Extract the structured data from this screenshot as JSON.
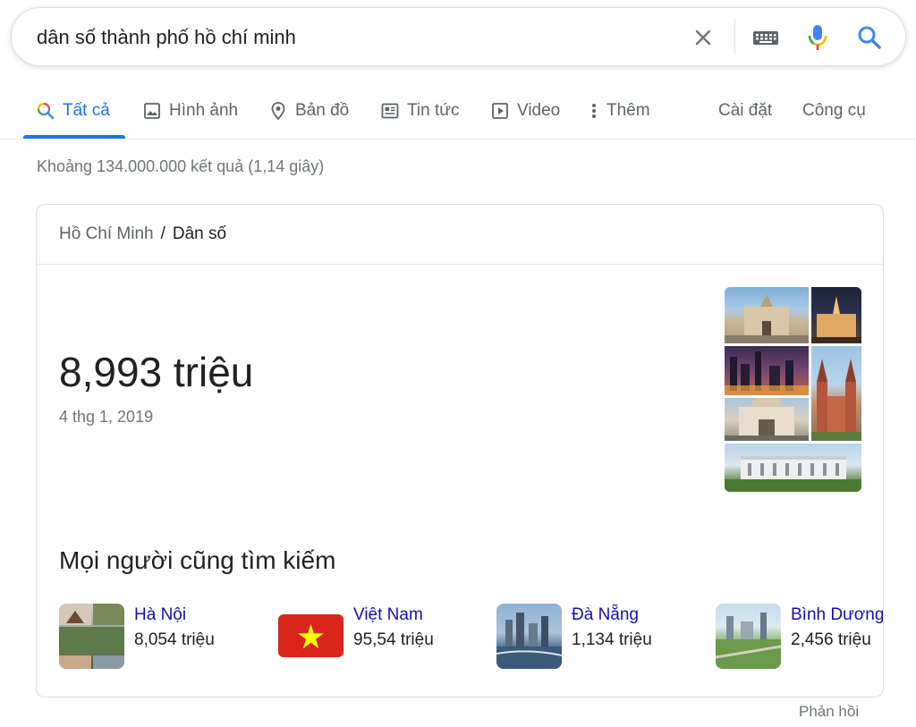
{
  "search": {
    "query": "dân số thành phố hồ chí minh"
  },
  "tabs": [
    {
      "label": "Tất cả",
      "icon": "search-icon",
      "active": true
    },
    {
      "label": "Hình ảnh",
      "icon": "image-icon"
    },
    {
      "label": "Bản đồ",
      "icon": "map-pin-icon"
    },
    {
      "label": "Tin tức",
      "icon": "news-icon"
    },
    {
      "label": "Video",
      "icon": "video-play-icon"
    },
    {
      "label": "Thêm",
      "icon": "more-vertical-icon"
    }
  ],
  "tools": {
    "settings_label": "Cài đặt",
    "tools_label": "Công cụ"
  },
  "result_stats": "Khoảng 134.000.000 kết quả (1,14 giây)",
  "card": {
    "breadcrumb": {
      "parent": "Hồ Chí Minh",
      "separator": "/",
      "current": "Dân số"
    },
    "population": "8,993 triệu",
    "date": "4 thg 1, 2019",
    "people_also_search": {
      "title": "Mọi người cũng tìm kiếm",
      "items": [
        {
          "name": "Hà Nội",
          "value": "8,054 triệu"
        },
        {
          "name": "Việt Nam",
          "value": "95,54 triệu"
        },
        {
          "name": "Đà Nẵng",
          "value": "1,134 triệu"
        },
        {
          "name": "Bình Dương",
          "value": "2,456 triệu"
        }
      ]
    }
  },
  "feedback_label": "Phản hồi",
  "colors": {
    "accent_blue": "#1a73e8",
    "link": "#1a0dab",
    "mic_red": "#ea4335",
    "flag_red": "#da251d",
    "flag_yellow": "#ffff00"
  }
}
